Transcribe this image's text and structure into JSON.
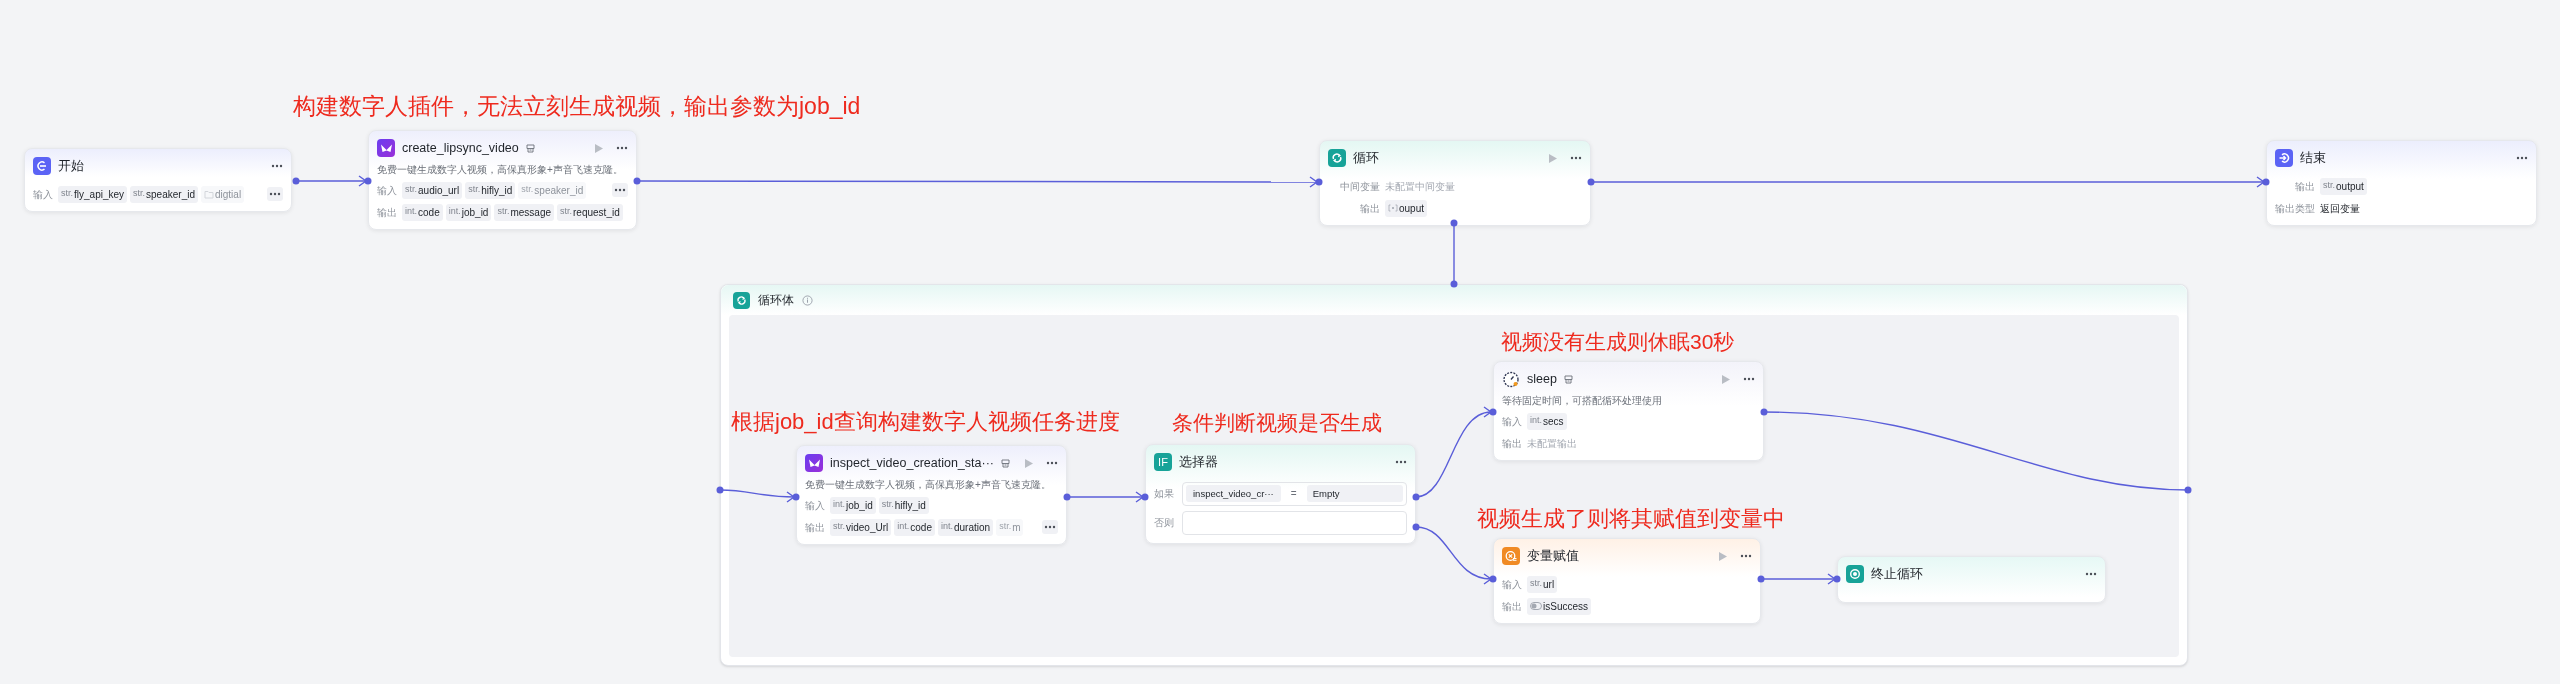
{
  "annotations": [
    "构建数字人插件，无法立刻生成视频，输出参数为job_id",
    "根据job_id查询构建数字人视频任务进度",
    "条件判断视频是否生成",
    "视频没有生成则休眠30秒",
    "视频生成了则将其赋值到变量中"
  ],
  "loop_body": {
    "title": "循环体"
  },
  "nodes": [
    {
      "kind": "start",
      "title": "开始",
      "plugin_badge": false,
      "run_button": false,
      "rows": [
        {
          "label": "输入",
          "more_button": true,
          "params": [
            {
              "kind": "typed",
              "type": "str.",
              "name": "fly_api_key",
              "faded": false
            },
            {
              "kind": "typed",
              "type": "str.",
              "name": "speaker_id",
              "faded": false
            },
            {
              "kind": "folder",
              "name": "digtial",
              "faded": true
            }
          ]
        }
      ]
    },
    {
      "kind": "plugin",
      "title": "create_lipsync_video",
      "plugin_badge": true,
      "run_button": true,
      "description": "免费一键生成数字人视频，高保真形象+声音飞速克隆。",
      "rows": [
        {
          "label": "输入",
          "more_button": true,
          "params": [
            {
              "kind": "typed",
              "type": "str.",
              "name": "audio_url",
              "faded": false
            },
            {
              "kind": "typed",
              "type": "str.",
              "name": "hifly_id",
              "faded": false
            },
            {
              "kind": "typed",
              "type": "str.",
              "name": "speaker_id",
              "faded": true
            }
          ]
        },
        {
          "label": "输出",
          "more_button": false,
          "params": [
            {
              "kind": "typed",
              "type": "int.",
              "name": "code",
              "faded": false
            },
            {
              "kind": "typed",
              "type": "int.",
              "name": "job_id",
              "faded": false
            },
            {
              "kind": "typed",
              "type": "str.",
              "name": "message",
              "faded": false
            },
            {
              "kind": "typed",
              "type": "str.",
              "name": "request_id",
              "faded": false
            }
          ]
        }
      ]
    },
    {
      "kind": "loop",
      "title": "循环",
      "plugin_badge": false,
      "run_button": true,
      "rows": [
        {
          "label": "中间变量",
          "value": "未配置中间变量",
          "muted": true
        },
        {
          "label": "输出",
          "more_button": false,
          "params": [
            {
              "kind": "array",
              "name": "ouput",
              "faded": false
            }
          ]
        }
      ]
    },
    {
      "kind": "end",
      "title": "结束",
      "plugin_badge": false,
      "run_button": false,
      "rows": [
        {
          "label": "输出",
          "more_button": false,
          "params": [
            {
              "kind": "typed",
              "type": "str.",
              "name": "output",
              "faded": false
            }
          ]
        },
        {
          "label": "输出类型",
          "value": "返回变量",
          "muted": false
        }
      ]
    },
    {
      "kind": "plugin",
      "title": "inspect_video_creation_sta···",
      "plugin_badge": true,
      "run_button": true,
      "description": "免费一键生成数字人视频，高保真形象+声音飞速克隆。",
      "rows": [
        {
          "label": "输入",
          "more_button": false,
          "params": [
            {
              "kind": "typed",
              "type": "int.",
              "name": "job_id",
              "faded": false
            },
            {
              "kind": "typed",
              "type": "str.",
              "name": "hifly_id",
              "faded": false
            }
          ]
        },
        {
          "label": "输出",
          "more_button": true,
          "params": [
            {
              "kind": "typed",
              "type": "str.",
              "name": "video_Url",
              "faded": false
            },
            {
              "kind": "typed",
              "type": "int.",
              "name": "code",
              "faded": false
            },
            {
              "kind": "typed",
              "type": "int.",
              "name": "duration",
              "faded": false
            },
            {
              "kind": "typed",
              "type": "str.",
              "name": "m",
              "faded": true
            }
          ]
        }
      ]
    },
    {
      "kind": "selector",
      "title": "选择器",
      "icon_text": "IF",
      "plugin_badge": false,
      "run_button": false,
      "conditions": [
        {
          "label": "如果",
          "left": "inspect_video_cr···",
          "operator": "=",
          "right": "Empty"
        },
        {
          "label": "否则"
        }
      ]
    },
    {
      "kind": "sleep",
      "title": "sleep",
      "plugin_badge": true,
      "run_button": true,
      "description": "等待固定时间，可搭配循环处理使用",
      "rows": [
        {
          "label": "输入",
          "more_button": false,
          "params": [
            {
              "kind": "typed",
              "type": "int.",
              "name": "secs",
              "faded": false
            }
          ]
        },
        {
          "label": "输出",
          "value": "未配置输出",
          "muted": true
        }
      ]
    },
    {
      "kind": "assign",
      "title": "变量赋值",
      "plugin_badge": false,
      "run_button": true,
      "rows": [
        {
          "label": "输入",
          "more_button": false,
          "params": [
            {
              "kind": "typed",
              "type": "str.",
              "name": "url",
              "faded": false
            }
          ]
        },
        {
          "label": "输出",
          "more_button": false,
          "params": [
            {
              "kind": "boolean",
              "name": "isSuccess",
              "faded": false
            }
          ]
        }
      ]
    },
    {
      "kind": "break",
      "title": "终止循环",
      "plugin_badge": false,
      "run_button": false
    }
  ]
}
